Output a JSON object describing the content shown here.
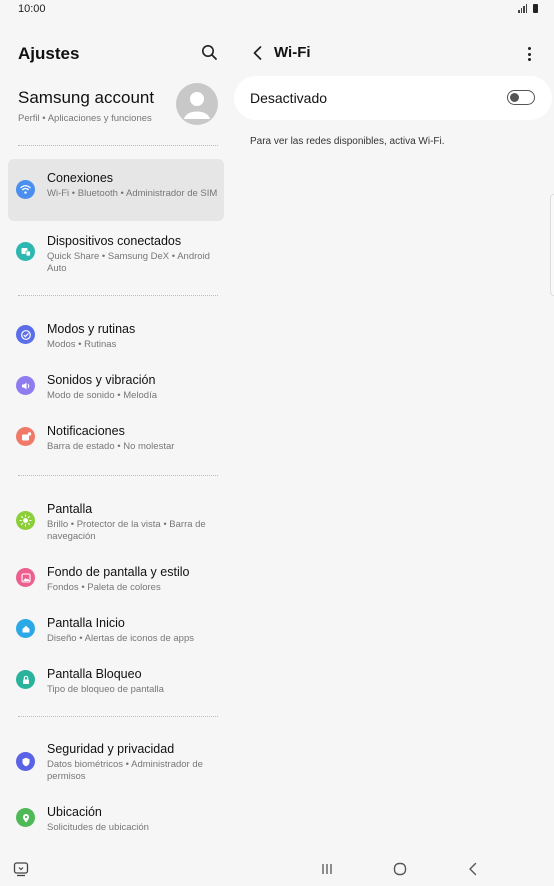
{
  "status": {
    "time": "10:00"
  },
  "left": {
    "title": "Ajustes",
    "account": {
      "name": "Samsung account",
      "sub": "Perfil  •  Aplicaciones y funciones"
    },
    "items": [
      {
        "title": "Conexiones",
        "sub": "Wi-Fi  •  Bluetooth  •  Administrador de SIM",
        "icon": "wifi-icon",
        "color": "#4a8ef0",
        "selected": true
      },
      {
        "title": "Dispositivos conectados",
        "sub": "Quick Share  •  Samsung DeX  •  Android Auto",
        "icon": "devices-icon",
        "color": "#2cb8b1"
      },
      {
        "title": "Modos y rutinas",
        "sub": "Modos  •  Rutinas",
        "icon": "check-circle-icon",
        "color": "#5b6ee8"
      },
      {
        "title": "Sonidos y vibración",
        "sub": "Modo de sonido  •  Melodía",
        "icon": "speaker-icon",
        "color": "#8f7df0"
      },
      {
        "title": "Notificaciones",
        "sub": "Barra de estado  •  No molestar",
        "icon": "notification-icon",
        "color": "#f07a67"
      },
      {
        "title": "Pantalla",
        "sub": "Brillo  •  Protector de la vista  •  Barra de navegación",
        "icon": "brightness-icon",
        "color": "#8ccf3a"
      },
      {
        "title": "Fondo de pantalla y estilo",
        "sub": "Fondos  •  Paleta de colores",
        "icon": "wallpaper-icon",
        "color": "#ec5f8e"
      },
      {
        "title": "Pantalla Inicio",
        "sub": "Diseño  •  Alertas de iconos de apps",
        "icon": "home-icon",
        "color": "#2aa9e6"
      },
      {
        "title": "Pantalla Bloqueo",
        "sub": "Tipo de bloqueo de pantalla",
        "icon": "lock-icon",
        "color": "#2ab39c"
      },
      {
        "title": "Seguridad y privacidad",
        "sub": "Datos biométricos  •  Administrador de permisos",
        "icon": "shield-icon",
        "color": "#5a63e6"
      },
      {
        "title": "Ubicación",
        "sub": "Solicitudes de ubicación",
        "icon": "location-icon",
        "color": "#4fb957"
      }
    ]
  },
  "right": {
    "title": "Wi-Fi",
    "toggle_label": "Desactivado",
    "toggle_on": false,
    "info": "Para ver las redes disponibles, activa Wi-Fi."
  }
}
